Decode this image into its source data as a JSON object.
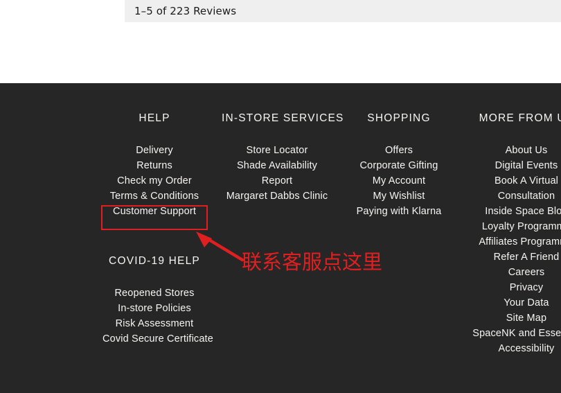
{
  "reviews": {
    "summary": "1–5 of 223 Reviews"
  },
  "footer": {
    "background_color": "#262626",
    "text_color": "#f7f5f1",
    "columns": [
      {
        "heading": "HELP",
        "links": [
          "Delivery",
          "Returns",
          "Check my Order",
          "Terms & Conditions",
          "Customer Support"
        ]
      },
      {
        "heading": "IN-STORE SERVICES",
        "links": [
          "Store Locator",
          "Shade Availability",
          "Report",
          "Margaret Dabbs Clinic"
        ]
      },
      {
        "heading": "SHOPPING",
        "links": [
          "Offers",
          "Corporate Gifting",
          "My Account",
          "My Wishlist",
          "Paying with Klarna"
        ]
      },
      {
        "heading": "MORE FROM US",
        "links": [
          "About Us",
          "Digital Events",
          "Book A Virtual",
          "Consultation",
          "Inside Space Blog",
          "Loyalty Programme",
          "Affiliates Programme",
          "Refer A Friend",
          "Careers",
          "Privacy",
          "Your Data",
          "Site Map",
          "SpaceNK and Essential",
          "Accessibility"
        ]
      }
    ],
    "covid_section": {
      "heading": "COVID-19 HELP",
      "links": [
        "Reopened Stores",
        "In-store Policies",
        "Risk Assessment",
        "Covid Secure Certificate"
      ]
    }
  },
  "annotation": {
    "color": "#e02020",
    "callout_text": "联系客服点这里",
    "highlighted_target": "Customer Support",
    "arrow_name": "red-arrow-icon"
  }
}
